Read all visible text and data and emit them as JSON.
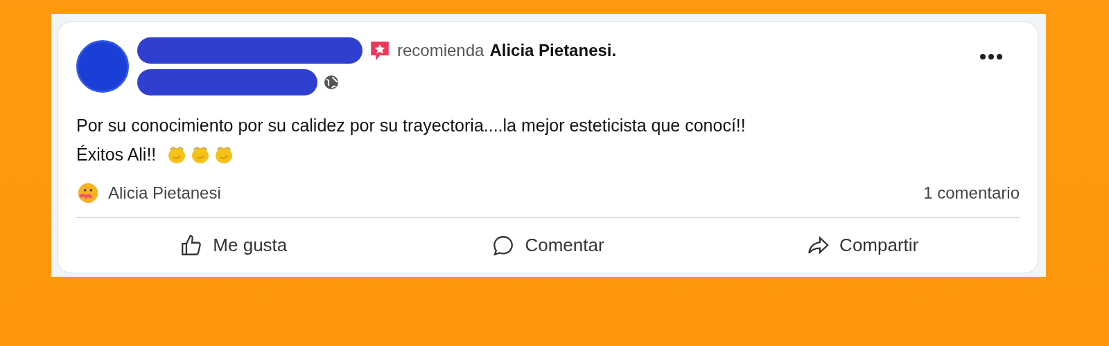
{
  "post": {
    "verb": "recomienda",
    "target": "Alicia Pietanesi.",
    "body": [
      "Por su conocimiento por su calidez por su trayectoria....la mejor esteticista que conocí!!",
      "Éxitos Ali!!"
    ],
    "body_emojis": [
      {
        "kind": "clap"
      },
      {
        "kind": "clap"
      },
      {
        "kind": "clap"
      }
    ],
    "reactor": "Alicia Pietanesi",
    "comments": "1 comentario",
    "actions": [
      {
        "kind": "like",
        "label": "Me gusta"
      },
      {
        "kind": "comment",
        "label": "Comentar"
      },
      {
        "kind": "share",
        "label": "Compartir"
      }
    ]
  }
}
